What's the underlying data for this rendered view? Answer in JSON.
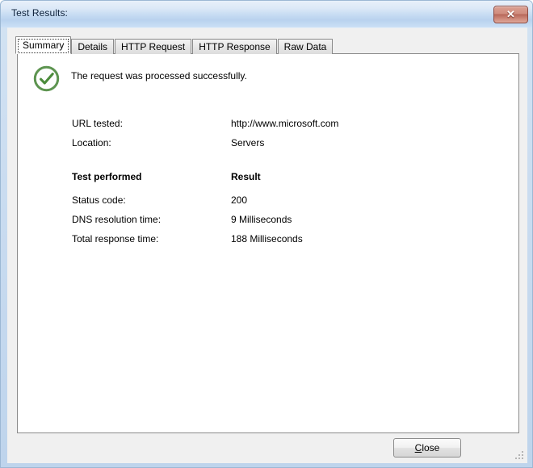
{
  "window": {
    "title": "Test Results:",
    "close_icon_glyph": "✕",
    "close_icon_name": "close-icon"
  },
  "tabs": [
    {
      "label": "Summary",
      "active": true
    },
    {
      "label": "Details",
      "active": false
    },
    {
      "label": "HTTP Request",
      "active": false
    },
    {
      "label": "HTTP Response",
      "active": false
    },
    {
      "label": "Raw Data",
      "active": false
    }
  ],
  "summary": {
    "status_icon": "success-check-icon",
    "status_message": "The request was processed successfully.",
    "info_rows": [
      {
        "label": "URL tested:",
        "value": "http://www.microsoft.com"
      },
      {
        "label": "Location:",
        "value": "Servers"
      }
    ],
    "results_header": {
      "label": "Test performed",
      "value": "Result"
    },
    "result_rows": [
      {
        "label": "Status code:",
        "value": "200"
      },
      {
        "label": "DNS resolution time:",
        "value": "9 Milliseconds"
      },
      {
        "label": "Total response time:",
        "value": "188 Milliseconds"
      }
    ]
  },
  "footer": {
    "close_button": {
      "accel": "C",
      "rest": "lose"
    }
  },
  "colors": {
    "success_green": "#4b8b3b",
    "titlebar_blue": "#cadcf0",
    "close_red": "#c07c6d",
    "panel_white": "#ffffff",
    "dialog_gray": "#f0f0f0"
  }
}
